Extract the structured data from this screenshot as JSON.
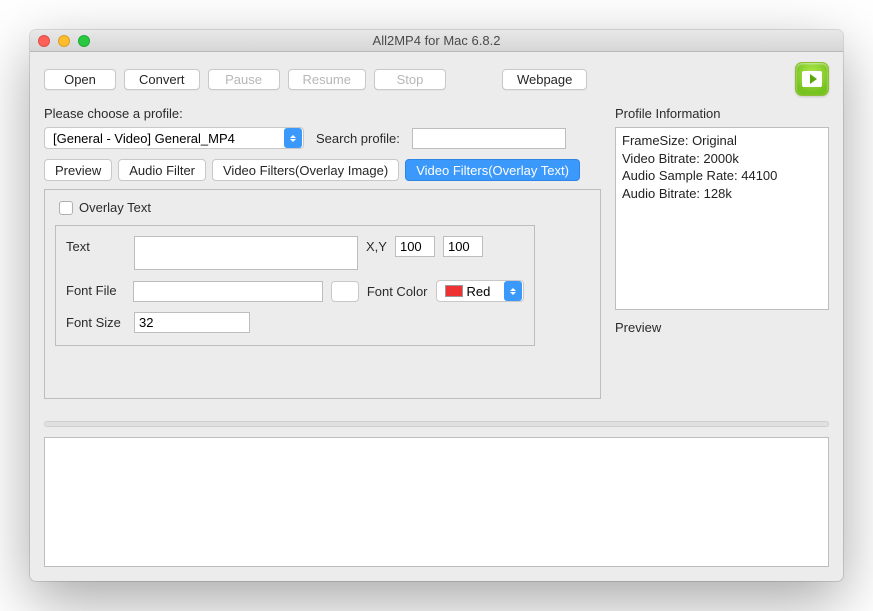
{
  "window": {
    "title": "All2MP4 for Mac 6.8.2"
  },
  "toolbar": {
    "open": "Open",
    "convert": "Convert",
    "pause": "Pause",
    "resume": "Resume",
    "stop": "Stop",
    "webpage": "Webpage"
  },
  "profile": {
    "choose_label": "Please choose a profile:",
    "selected": "[General - Video] General_MP4",
    "search_label": "Search profile:",
    "search_value": ""
  },
  "tabs": {
    "preview": "Preview",
    "audio_filter": "Audio Filter",
    "video_overlay_image": "Video Filters(Overlay Image)",
    "video_overlay_text": "Video Filters(Overlay Text)"
  },
  "overlay_text": {
    "checkbox_label": "Overlay Text",
    "text_label": "Text",
    "text_value": "",
    "xy_label": "X,Y",
    "x_value": "100",
    "y_value": "100",
    "font_file_label": "Font File",
    "font_file_value": "",
    "font_color_label": "Font Color",
    "font_color_value": "Red",
    "font_size_label": "Font Size",
    "font_size_value": "32"
  },
  "profile_info": {
    "heading": "Profile Information",
    "lines": {
      "framesize": "FrameSize: Original",
      "vbitrate": "Video Bitrate: 2000k",
      "asample": "Audio Sample Rate: 44100",
      "abitrate": "Audio Bitrate: 128k"
    },
    "preview_label": "Preview"
  }
}
